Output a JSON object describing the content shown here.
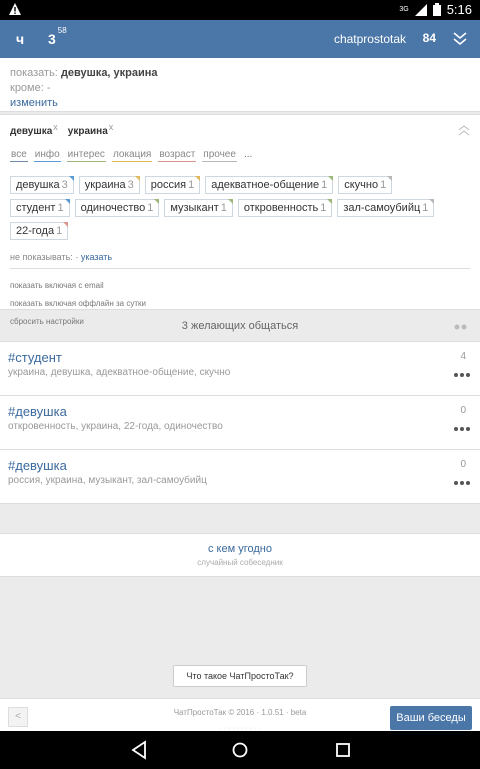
{
  "status": {
    "time": "5:16",
    "network": "3G"
  },
  "header": {
    "letter": "ч",
    "count": "3",
    "count_sup": "58",
    "username": "chatprostotak",
    "number": "84"
  },
  "summary": {
    "show_label": "показать:",
    "show_values": "девушка, украина",
    "except_label": "кроме: -",
    "change_link": "изменить"
  },
  "selected_tags": [
    {
      "label": "девушка",
      "x": "x"
    },
    {
      "label": "украина",
      "x": "x"
    }
  ],
  "filters": [
    {
      "label": "все",
      "color": "#6f8ba8"
    },
    {
      "label": "инфо",
      "color": "#5a9bd5"
    },
    {
      "label": "интерес",
      "color": "#9bb87a"
    },
    {
      "label": "локация",
      "color": "#e0b85c"
    },
    {
      "label": "возраст",
      "color": "#d9948c"
    },
    {
      "label": "прочее",
      "color": "#b8b8b8"
    }
  ],
  "filters_more": "...",
  "tags": [
    {
      "label": "девушка",
      "n": "3",
      "color": "#5a9bd5"
    },
    {
      "label": "украина",
      "n": "3",
      "color": "#e0b85c"
    },
    {
      "label": "россия",
      "n": "1",
      "color": "#e0b85c"
    },
    {
      "label": "адекватное-общение",
      "n": "1",
      "color": "#9bb87a"
    },
    {
      "label": "скучно",
      "n": "1",
      "color": "#b8b8b8"
    },
    {
      "label": "студент",
      "n": "1",
      "color": "#5a9bd5"
    },
    {
      "label": "одиночество",
      "n": "1",
      "color": "#9bb87a"
    },
    {
      "label": "музыкант",
      "n": "1",
      "color": "#9bb87a"
    },
    {
      "label": "откровенность",
      "n": "1",
      "color": "#9bb87a"
    },
    {
      "label": "зал-самоубийц",
      "n": "1",
      "color": "#b8b8b8"
    },
    {
      "label": "22-года",
      "n": "1",
      "color": "#d9948c"
    }
  ],
  "hidden": {
    "label": "не показывать:",
    "dot": "·",
    "link": "указать"
  },
  "options": {
    "with_email": "показать включая с email",
    "with_offline": "показать включая оффлайн за сутки",
    "reset": "сбросить настройки"
  },
  "count_text": "3 желающих общаться",
  "results": [
    {
      "title": "#студент",
      "tags": "украина, девушка, адекватное-общение, скучно",
      "num": "4"
    },
    {
      "title": "#девушка",
      "tags": "откровенность, украина, 22-года, одиночество",
      "num": "0"
    },
    {
      "title": "#девушка",
      "tags": "россия, украина, музыкант, зал-самоубийц",
      "num": "0"
    }
  ],
  "anyone": {
    "title": "с кем угодно",
    "subtitle": "случайный собеседник"
  },
  "what_button": "Что такое ЧатПростоТак?",
  "footer": {
    "back": "<",
    "copyright": "ЧатПростоТак © 2016 · 1.0.51 · beta",
    "copyright2": "· · · · · · · · · ·",
    "dialogs_button": "Ваши беседы"
  },
  "colors": {
    "accent": "#4a76a8",
    "link": "#3a6a9e"
  },
  "icons": {
    "warning": "warning-icon",
    "signal": "signal-icon",
    "battery": "battery-icon",
    "chevron": "double-chevron-icon",
    "collapse": "collapse-icon",
    "more": "more-dots-icon",
    "nav_back": "nav-back-icon",
    "nav_home": "nav-home-icon",
    "nav_recent": "nav-recent-icon"
  }
}
